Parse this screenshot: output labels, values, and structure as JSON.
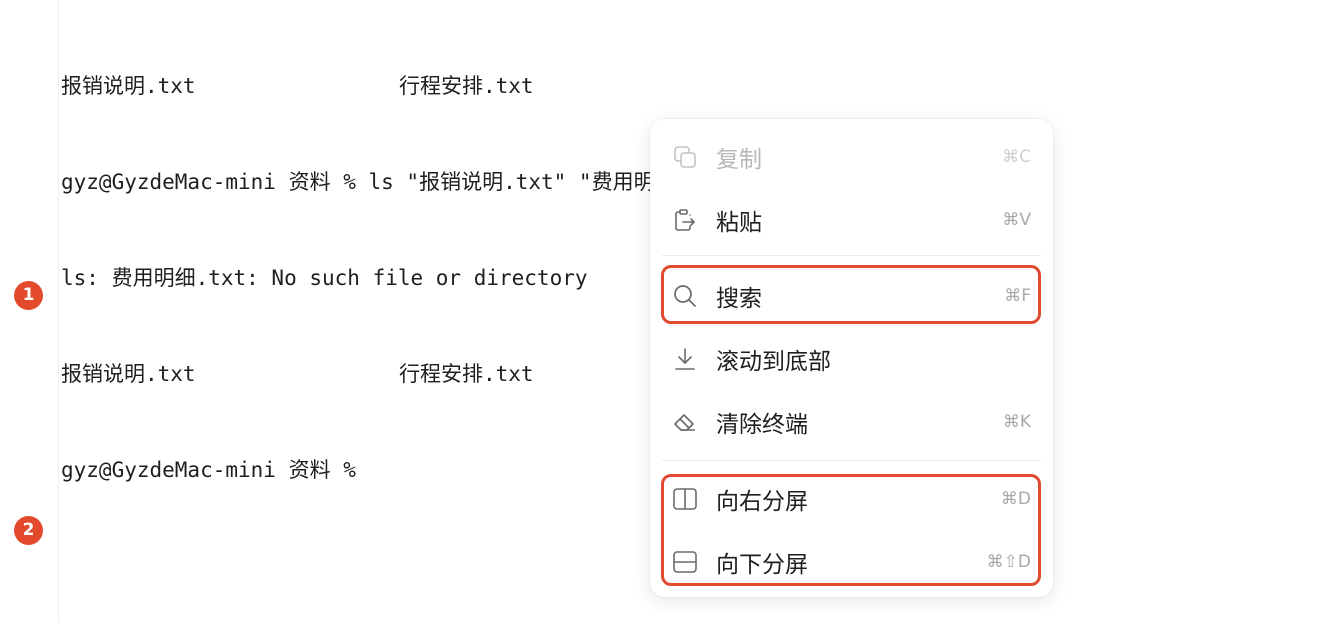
{
  "terminal": {
    "lines": [
      {
        "col1": "报销说明.txt",
        "col2": "行程安排.txt"
      },
      {
        "text": "gyz@GyzdeMac-mini 资料 % ls \"报销说明.txt\" \"费用明细.txt\" \"行程安排.txt\""
      },
      {
        "text": "ls: 费用明细.txt: No such file or directory"
      },
      {
        "col1": "报销说明.txt",
        "col2": "行程安排.txt"
      },
      {
        "text": "gyz@GyzdeMac-mini 资料 %"
      }
    ]
  },
  "markers": [
    "1",
    "2"
  ],
  "menu": {
    "items": [
      {
        "label": "复制",
        "shortcut": "⌘C",
        "icon": "copy-icon",
        "disabled": true
      },
      {
        "label": "粘贴",
        "shortcut": "⌘V",
        "icon": "paste-icon"
      },
      {
        "label": "搜索",
        "shortcut": "⌘F",
        "icon": "search-icon"
      },
      {
        "label": "滚动到底部",
        "shortcut": "",
        "icon": "arrow-down-icon"
      },
      {
        "label": "清除终端",
        "shortcut": "⌘K",
        "icon": "eraser-icon"
      },
      {
        "label": "向右分屏",
        "shortcut": "⌘D",
        "icon": "split-right-icon"
      },
      {
        "label": "向下分屏",
        "shortcut": "⌘⇧D",
        "icon": "split-down-icon"
      }
    ]
  },
  "colors": {
    "highlight": "#e04a30",
    "marker": "#e34a2b"
  }
}
